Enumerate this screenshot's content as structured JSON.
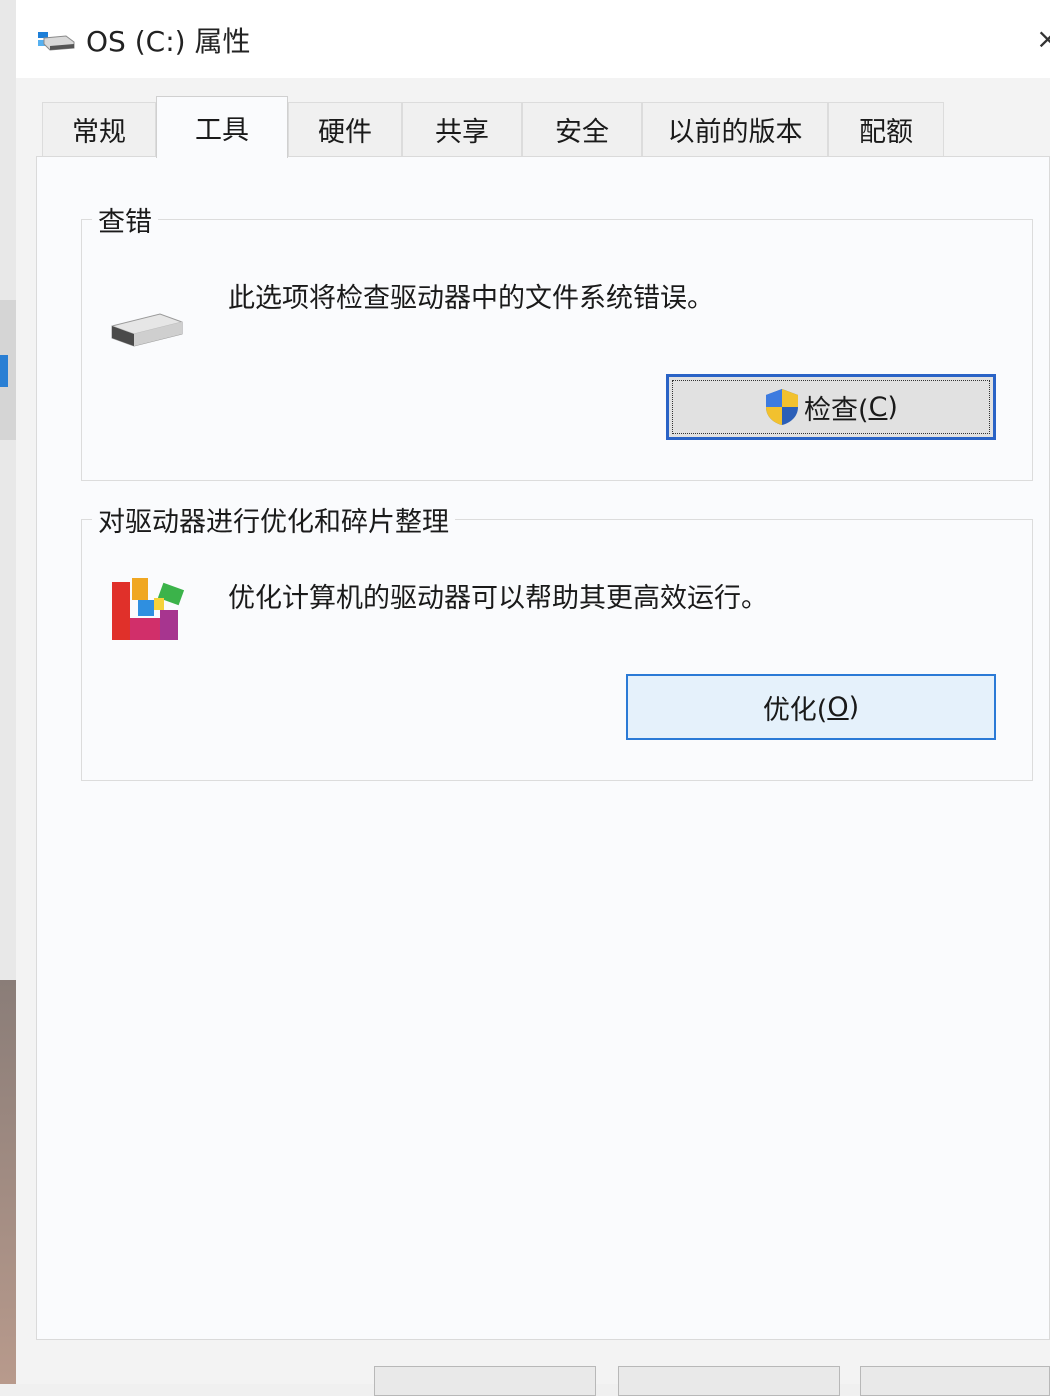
{
  "window": {
    "title": "OS (C:) 属性",
    "close_icon": "×"
  },
  "tabs": [
    {
      "label": "常规",
      "active": false
    },
    {
      "label": "工具",
      "active": true
    },
    {
      "label": "硬件",
      "active": false
    },
    {
      "label": "共享",
      "active": false
    },
    {
      "label": "安全",
      "active": false
    },
    {
      "label": "以前的版本",
      "active": false
    },
    {
      "label": "配额",
      "active": false
    }
  ],
  "error_check": {
    "group_label": "查错",
    "description": "此选项将检查驱动器中的文件系统错误。",
    "button_label": "检查(",
    "button_mnemonic": "C",
    "button_suffix": ")",
    "icon": "drive-icon",
    "button_icon": "uac-shield-icon"
  },
  "optimize": {
    "group_label": "对驱动器进行优化和碎片整理",
    "description": "优化计算机的驱动器可以帮助其更高效运行。",
    "button_label": "优化(",
    "button_mnemonic": "O",
    "button_suffix": ")",
    "icon": "defrag-icon"
  },
  "colors": {
    "focus_border": "#2a63c6",
    "optimize_button_bg": "#e5f1fb",
    "optimize_button_border": "#2b7ad6"
  }
}
